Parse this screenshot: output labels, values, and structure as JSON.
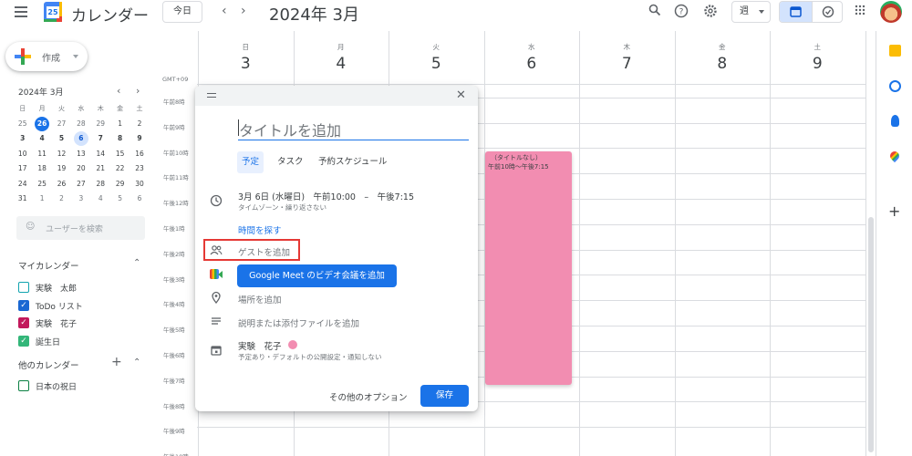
{
  "header": {
    "app_title": "カレンダー",
    "logo_day": "25",
    "today_button": "今日",
    "date_title": "2024年 3月",
    "view_select": "週"
  },
  "sidebar": {
    "create_label": "作成",
    "mini_calendar": {
      "title": "2024年 3月",
      "weekdays": [
        "日",
        "月",
        "火",
        "水",
        "木",
        "金",
        "土"
      ],
      "weeks": [
        [
          "25",
          "26",
          "27",
          "28",
          "29",
          "1",
          "2"
        ],
        [
          "3",
          "4",
          "5",
          "6",
          "7",
          "8",
          "9"
        ],
        [
          "10",
          "11",
          "12",
          "13",
          "14",
          "15",
          "16"
        ],
        [
          "17",
          "18",
          "19",
          "20",
          "21",
          "22",
          "23"
        ],
        [
          "24",
          "25",
          "26",
          "27",
          "28",
          "29",
          "30"
        ],
        [
          "31",
          "1",
          "2",
          "3",
          "4",
          "5",
          "6"
        ]
      ]
    },
    "user_search_placeholder": "ユーザーを検索",
    "my_calendars_label": "マイカレンダー",
    "my_calendars": [
      {
        "name": "実験　太郎",
        "color": "#12a4af",
        "checked": false
      },
      {
        "name": "ToDo リスト",
        "color": "#1967d2",
        "checked": true
      },
      {
        "name": "実験　花子",
        "color": "#c2185b",
        "checked": true
      },
      {
        "name": "誕生日",
        "color": "#33b679",
        "checked": true
      }
    ],
    "other_calendars_label": "他のカレンダー",
    "other_calendars": [
      {
        "name": "日本の祝日",
        "color": "#0b8043",
        "checked": false
      }
    ]
  },
  "week": {
    "timezone": "GMT+09",
    "days": [
      {
        "dow": "日",
        "num": "3"
      },
      {
        "dow": "月",
        "num": "4"
      },
      {
        "dow": "火",
        "num": "5"
      },
      {
        "dow": "水",
        "num": "6"
      },
      {
        "dow": "木",
        "num": "7"
      },
      {
        "dow": "金",
        "num": "8"
      },
      {
        "dow": "土",
        "num": "9"
      }
    ],
    "hours": [
      "午前8時",
      "午前9時",
      "午前10時",
      "午前11時",
      "午後12時",
      "午後1時",
      "午後2時",
      "午後3時",
      "午後4時",
      "午後5時",
      "午後6時",
      "午後7時",
      "午後8時",
      "午後9時",
      "午後10時"
    ]
  },
  "event": {
    "title": "（タイトルなし）",
    "time": "午前10時～午後7:15",
    "color": "#f28db1"
  },
  "dialog": {
    "title_placeholder": "タイトルを追加",
    "tabs": [
      "予定",
      "タスク",
      "予約スケジュール"
    ],
    "date_time": "3月 6日 (水曜日)　午前10:00　–　午後7:15",
    "date_sub": "タイムゾーン・繰り返さない",
    "find_time": "時間を探す",
    "add_guests": "ゲストを追加",
    "meet_button": "Google Meet のビデオ会議を追加",
    "add_location": "場所を追加",
    "add_description": "説明または添付ファイルを追加",
    "calendar_owner": "実験　花子",
    "calendar_sub": "予定あり・デフォルトの公開設定・通知しない",
    "more_options": "その他のオプション",
    "save": "保存"
  },
  "colors": {
    "accent": "#1a73e8",
    "highlight_box": "#e53935",
    "event": "#f28db1"
  }
}
